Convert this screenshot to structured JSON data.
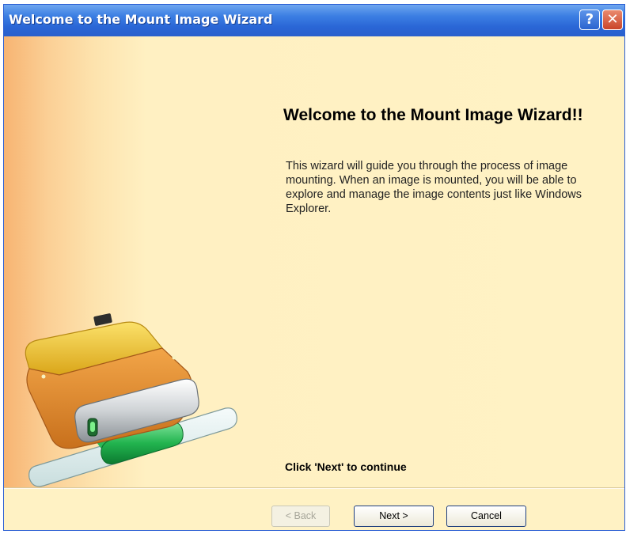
{
  "window": {
    "title": "Welcome to the Mount Image Wizard",
    "help_button": "?",
    "close_button": "✕"
  },
  "content": {
    "heading": "Welcome to the Mount Image Wizard!!",
    "description": "This wizard will guide you through the process of image mounting. When an image is mounted, you will be able to explore and manage the image contents just like Windows Explorer.",
    "continue_hint": "Click 'Next' to continue",
    "illustration_icon": "mount-drive-icon"
  },
  "buttons": {
    "back": "< Back",
    "next": "Next >",
    "cancel": "Cancel"
  },
  "colors": {
    "titlebar": "#2a66d6",
    "background": "#fff2c0",
    "accent_orange": "#f7b472"
  }
}
